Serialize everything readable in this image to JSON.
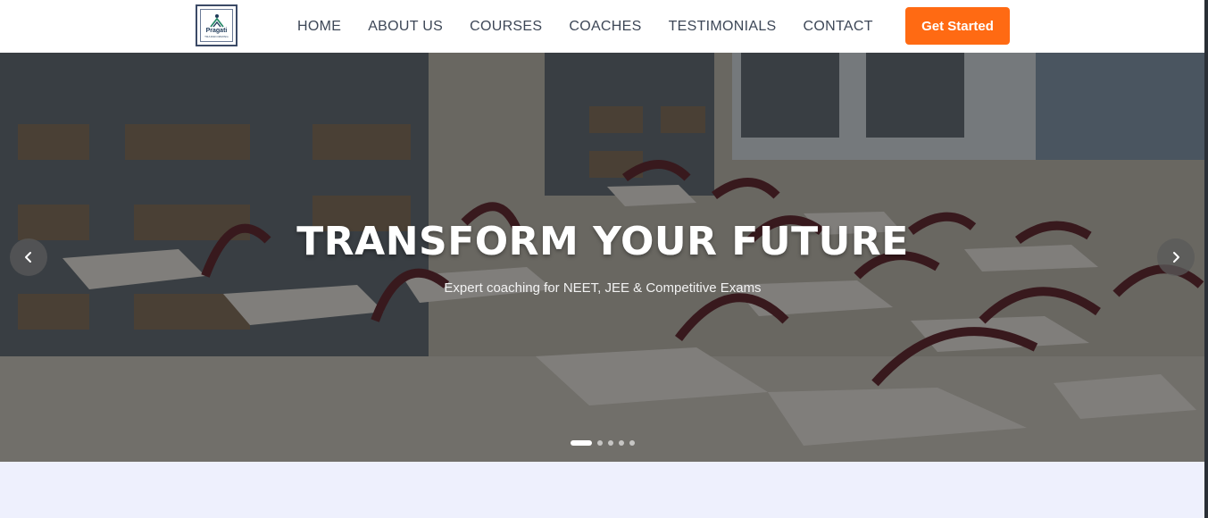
{
  "header": {
    "logo": {
      "name": "Pragati",
      "tagline": "TRANSFORMING"
    },
    "nav": [
      {
        "label": "HOME"
      },
      {
        "label": "ABOUT US"
      },
      {
        "label": "COURSES"
      },
      {
        "label": "COACHES"
      },
      {
        "label": "TESTIMONIALS"
      },
      {
        "label": "CONTACT"
      }
    ],
    "cta_label": "Get Started"
  },
  "hero": {
    "title": "TRANSFORM YOUR FUTURE",
    "subtitle": "Expert coaching for NEET, JEE & Competitive Exams",
    "prev_icon": "chevron-left-icon",
    "next_icon": "chevron-right-icon",
    "slides_count": 5,
    "active_slide": 1
  },
  "colors": {
    "accent": "#ff6a13",
    "nav_text": "#3d4757",
    "section_bg": "#eef0fd"
  }
}
